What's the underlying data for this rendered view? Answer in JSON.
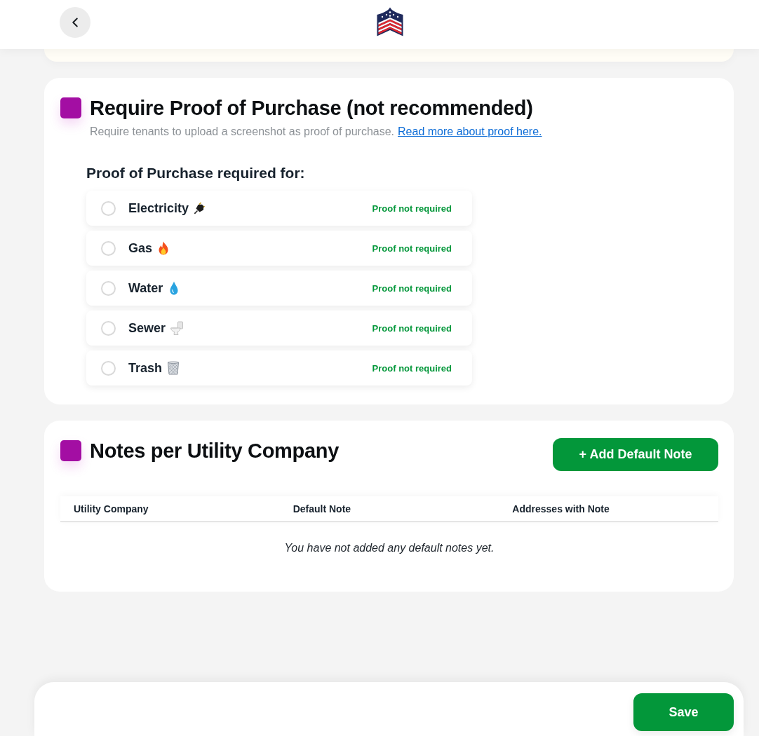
{
  "proof_section": {
    "title": "Require Proof of Purchase (not recommended)",
    "description": "Require tenants to upload a screenshot as proof of purchase.",
    "link": "Read more about proof here.",
    "subheading": "Proof of Purchase required for:",
    "utilities": [
      {
        "name": "Electricity",
        "selected": false,
        "status": "Proof not required"
      },
      {
        "name": "Gas",
        "selected": false,
        "status": "Proof not required"
      },
      {
        "name": "Water",
        "selected": false,
        "status": "Proof not required"
      },
      {
        "name": "Sewer",
        "selected": false,
        "status": "Proof not required"
      },
      {
        "name": "Trash",
        "selected": false,
        "status": "Proof not required"
      }
    ]
  },
  "notes_section": {
    "title": "Notes per Utility Company",
    "add_button": "+ Add Default Note",
    "table": {
      "columns": [
        "Utility Company",
        "Default Note",
        "Addresses with Note"
      ],
      "empty_message": "You have not added any default notes yet."
    }
  },
  "footer": {
    "save_button": "Save"
  }
}
